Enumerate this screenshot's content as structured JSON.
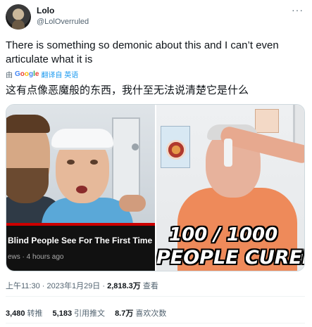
{
  "author": {
    "name": "Lolo",
    "handle": "@LolOverruled"
  },
  "menu": {
    "more_label": "···"
  },
  "tweet": {
    "text": "There is something so demonic about this and I can’t even articulate what it is",
    "translate_prefix": "由",
    "google_label": "Google",
    "translate_link": "翻译自 英语",
    "translated_text": "这有点像恶魔般的东西，我什至无法说清楚它是什么"
  },
  "media": {
    "left": {
      "video_title": "Blind People See For The First Time",
      "video_meta": "ews · 4 hours ago"
    },
    "right": {
      "caption_line1": "100 / 1000",
      "caption_line2": "PEOPLE CURED"
    }
  },
  "meta": {
    "time": "上午11:30 · 2023年1月29日 · ",
    "views_count": "2,818.3万",
    "views_label": " 查看"
  },
  "stats": {
    "retweets_count": "3,480",
    "retweets_label": "转推",
    "quotes_count": "5,183",
    "quotes_label": "引用推文",
    "likes_count": "8.7万",
    "likes_label": "喜欢次数"
  },
  "colors": {
    "accent": "#1d9bf0",
    "text_primary": "#0f1419",
    "text_secondary": "#536471",
    "youtube_red": "#cc0000"
  }
}
